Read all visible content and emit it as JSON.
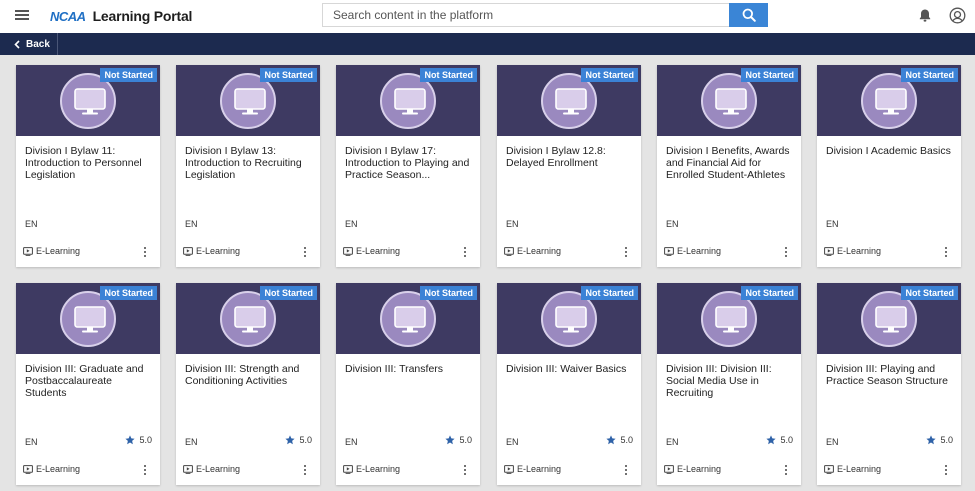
{
  "header": {
    "logo_mark": "NCAA",
    "logo_text": "Learning Portal",
    "search_placeholder": "Search content in the platform"
  },
  "nav": {
    "back_label": "Back"
  },
  "colors": {
    "header_bg": "#ffffff",
    "nav_bg": "#1c2a4f",
    "thumb_bg": "#3e3a62",
    "badge_bg": "#3b82d6",
    "accent": "#3a85d6"
  },
  "icons": {
    "menu": "menu-icon",
    "search": "search-icon",
    "bell": "bell-icon",
    "avatar": "avatar-icon",
    "monitor": "monitor-icon",
    "star": "star-icon",
    "elearning": "elearning-icon",
    "more": "more-vert-icon",
    "back": "chevron-left-icon"
  },
  "cards": [
    {
      "title": "Division I Bylaw 11: Introduction to Personnel Legislation",
      "status": "Not Started",
      "language": "EN",
      "type": "E-Learning",
      "rating": ""
    },
    {
      "title": "Division I Bylaw 13: Introduction to Recruiting Legislation",
      "status": "Not Started",
      "language": "EN",
      "type": "E-Learning",
      "rating": ""
    },
    {
      "title": "Division I Bylaw 17: Introduction to Playing and Practice Season...",
      "status": "Not Started",
      "language": "EN",
      "type": "E-Learning",
      "rating": ""
    },
    {
      "title": "Division I Bylaw 12.8: Delayed Enrollment",
      "status": "Not Started",
      "language": "EN",
      "type": "E-Learning",
      "rating": ""
    },
    {
      "title": "Division I Benefits, Awards and Financial Aid for Enrolled Student-Athletes",
      "status": "Not Started",
      "language": "EN",
      "type": "E-Learning",
      "rating": ""
    },
    {
      "title": "Division I Academic Basics",
      "status": "Not Started",
      "language": "EN",
      "type": "E-Learning",
      "rating": ""
    },
    {
      "title": "Division III: Graduate and Postbaccalaureate Students",
      "status": "Not Started",
      "language": "EN",
      "type": "E-Learning",
      "rating": "5.0"
    },
    {
      "title": "Division III: Strength and Conditioning Activities",
      "status": "Not Started",
      "language": "EN",
      "type": "E-Learning",
      "rating": "5.0"
    },
    {
      "title": "Division III: Transfers",
      "status": "Not Started",
      "language": "EN",
      "type": "E-Learning",
      "rating": "5.0"
    },
    {
      "title": "Division III: Waiver Basics",
      "status": "Not Started",
      "language": "EN",
      "type": "E-Learning",
      "rating": "5.0"
    },
    {
      "title": "Division III: Division III: Social Media Use in Recruiting",
      "status": "Not Started",
      "language": "EN",
      "type": "E-Learning",
      "rating": "5.0"
    },
    {
      "title": "Division III: Playing and Practice Season Structure",
      "status": "Not Started",
      "language": "EN",
      "type": "E-Learning",
      "rating": "5.0"
    }
  ]
}
